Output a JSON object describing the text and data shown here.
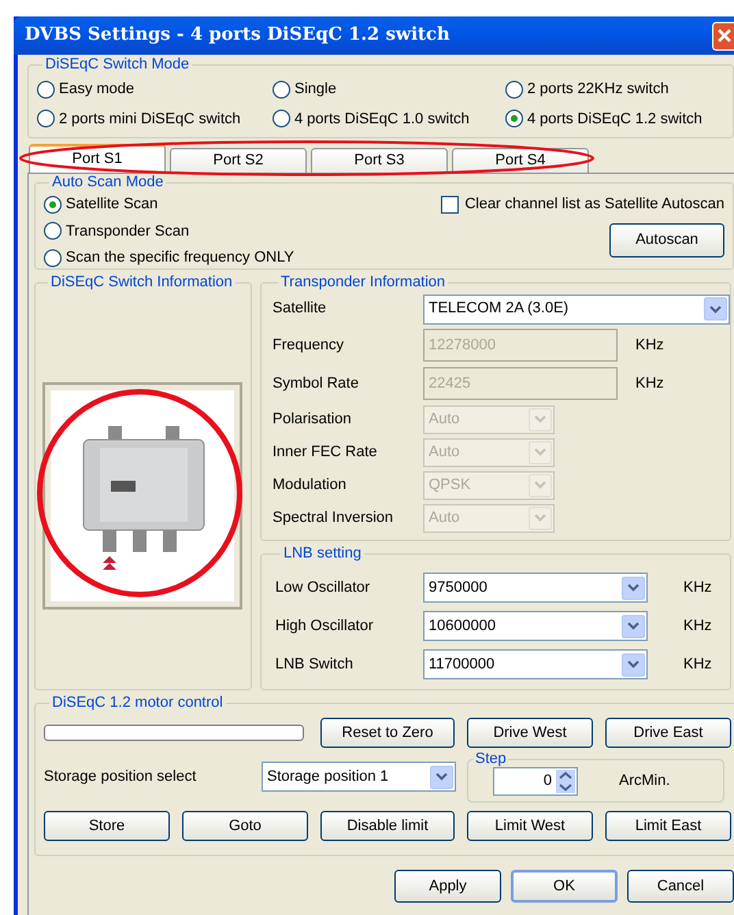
{
  "window": {
    "title": "DVBS Settings - 4 ports DiSEqC 1.2 switch"
  },
  "switch_mode": {
    "title": "DiSEqC Switch Mode",
    "options": [
      {
        "label": "Easy mode",
        "selected": false
      },
      {
        "label": "Single",
        "selected": false
      },
      {
        "label": "2 ports 22KHz switch",
        "selected": false
      },
      {
        "label": "2 ports mini DiSEqC switch",
        "selected": false
      },
      {
        "label": "4 ports DiSEqC 1.0 switch",
        "selected": false
      },
      {
        "label": "4 ports DiSEqC 1.2 switch",
        "selected": true
      }
    ]
  },
  "tabs": [
    {
      "label": "Port S1",
      "selected": true
    },
    {
      "label": "Port S2",
      "selected": false
    },
    {
      "label": "Port S3",
      "selected": false
    },
    {
      "label": "Port S4",
      "selected": false
    }
  ],
  "auto_scan": {
    "title": "Auto Scan Mode",
    "options": [
      {
        "label": "Satellite Scan",
        "selected": true
      },
      {
        "label": "Transponder Scan",
        "selected": false
      },
      {
        "label": "Scan the specific frequency ONLY",
        "selected": false
      }
    ],
    "clear_option": {
      "label": "Clear channel list as Satellite Autoscan",
      "checked": false
    },
    "button": "Autoscan"
  },
  "switch_info": {
    "title": "DiSEqC Switch Information"
  },
  "transponder": {
    "title": "Transponder Information",
    "fields": [
      {
        "kind": "select",
        "label": "Satellite",
        "value": "TELECOM 2A (3.0E)",
        "disabled": false
      },
      {
        "kind": "text",
        "label": "Frequency",
        "value": "12278000",
        "unit": "KHz",
        "disabled": true
      },
      {
        "kind": "text",
        "label": "Symbol Rate",
        "value": "22425",
        "unit": "KHz",
        "disabled": true
      },
      {
        "kind": "combo",
        "label": "Polarisation",
        "value": "Auto",
        "disabled": true
      },
      {
        "kind": "combo",
        "label": "Inner FEC Rate",
        "value": "Auto",
        "disabled": true
      },
      {
        "kind": "combo",
        "label": "Modulation",
        "value": "QPSK",
        "disabled": true
      },
      {
        "kind": "combo",
        "label": "Spectral Inversion",
        "value": "Auto",
        "disabled": true
      }
    ]
  },
  "lnb": {
    "title": "LNB setting",
    "fields": [
      {
        "label": "Low Oscillator",
        "value": "9750000",
        "unit": "KHz"
      },
      {
        "label": "High Oscillator",
        "value": "10600000",
        "unit": "KHz"
      },
      {
        "label": "LNB Switch",
        "value": "11700000",
        "unit": "KHz"
      }
    ]
  },
  "motor": {
    "title": "DiSEqC 1.2 motor control",
    "progress": {
      "level": 0
    },
    "top_buttons": [
      "Reset to Zero",
      "Drive West",
      "Drive East"
    ],
    "storage_label": "Storage position select",
    "storage_value": "Storage position  1",
    "step": {
      "title": "Step",
      "value": "0",
      "unit": "ArcMin."
    },
    "bottom_buttons": [
      "Store",
      "Goto",
      "Disable limit",
      "Limit West",
      "Limit East"
    ]
  },
  "footer_buttons": [
    {
      "label": "Apply",
      "default": false
    },
    {
      "label": "OK",
      "default": true
    },
    {
      "label": "Cancel",
      "default": false
    }
  ]
}
